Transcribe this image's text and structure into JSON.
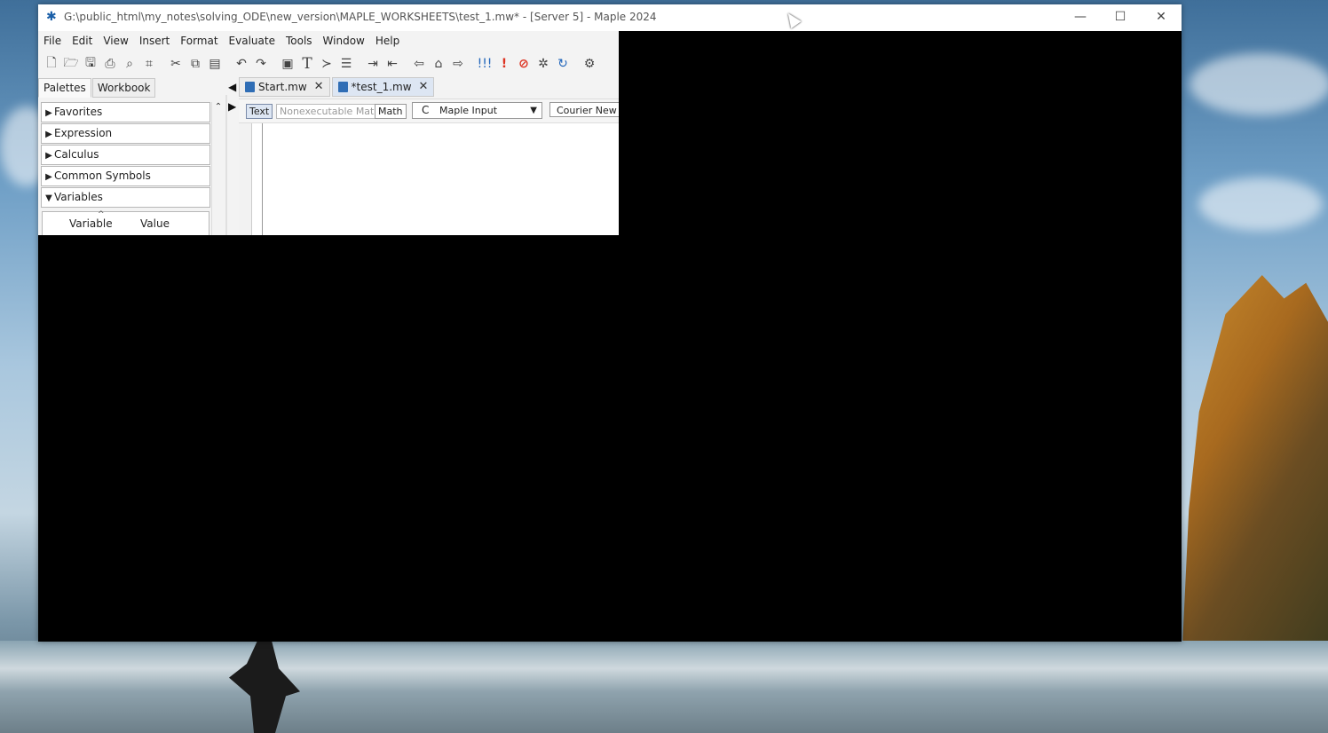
{
  "window": {
    "title": "G:\\public_html\\my_notes\\solving_ODE\\new_version\\MAPLE_WORKSHEETS\\test_1.mw* - [Server 5] - Maple 2024",
    "controls": {
      "minimize": "—",
      "maximize": "☐",
      "close": "✕"
    }
  },
  "menubar": {
    "items": [
      "File",
      "Edit",
      "View",
      "Insert",
      "Format",
      "Evaluate",
      "Tools",
      "Window",
      "Help"
    ]
  },
  "toolbar": {
    "buttons": [
      "new-document",
      "open",
      "save",
      "print",
      "print-preview",
      "crop",
      "cut",
      "copy",
      "paste",
      "undo",
      "redo",
      "math-mode",
      "text-mode",
      "command-prompt",
      "execution-group",
      "indent",
      "outdent",
      "back",
      "home",
      "forward",
      "execute-all",
      "execute",
      "stop",
      "debug",
      "restart",
      "settings"
    ]
  },
  "panel": {
    "tabs": [
      "Palettes",
      "Workbook"
    ],
    "palettes": [
      {
        "label": "Favorites",
        "expanded": false
      },
      {
        "label": "Expression",
        "expanded": false
      },
      {
        "label": "Calculus",
        "expanded": false
      },
      {
        "label": "Common Symbols",
        "expanded": false
      },
      {
        "label": "Variables",
        "expanded": true
      }
    ],
    "variables_table": {
      "col_variable": "Variable",
      "col_value": "Value"
    }
  },
  "documents": {
    "tabs": [
      {
        "label": "Start.mw",
        "active": false
      },
      {
        "label": "*test_1.mw",
        "active": true
      }
    ],
    "close_glyph": "✕"
  },
  "context_bar": {
    "text_btn": "Text",
    "nonexec_btn": "Nonexecutable Math",
    "math_btn": "Math",
    "input_mode": "Maple Input",
    "font": "Courier New"
  }
}
